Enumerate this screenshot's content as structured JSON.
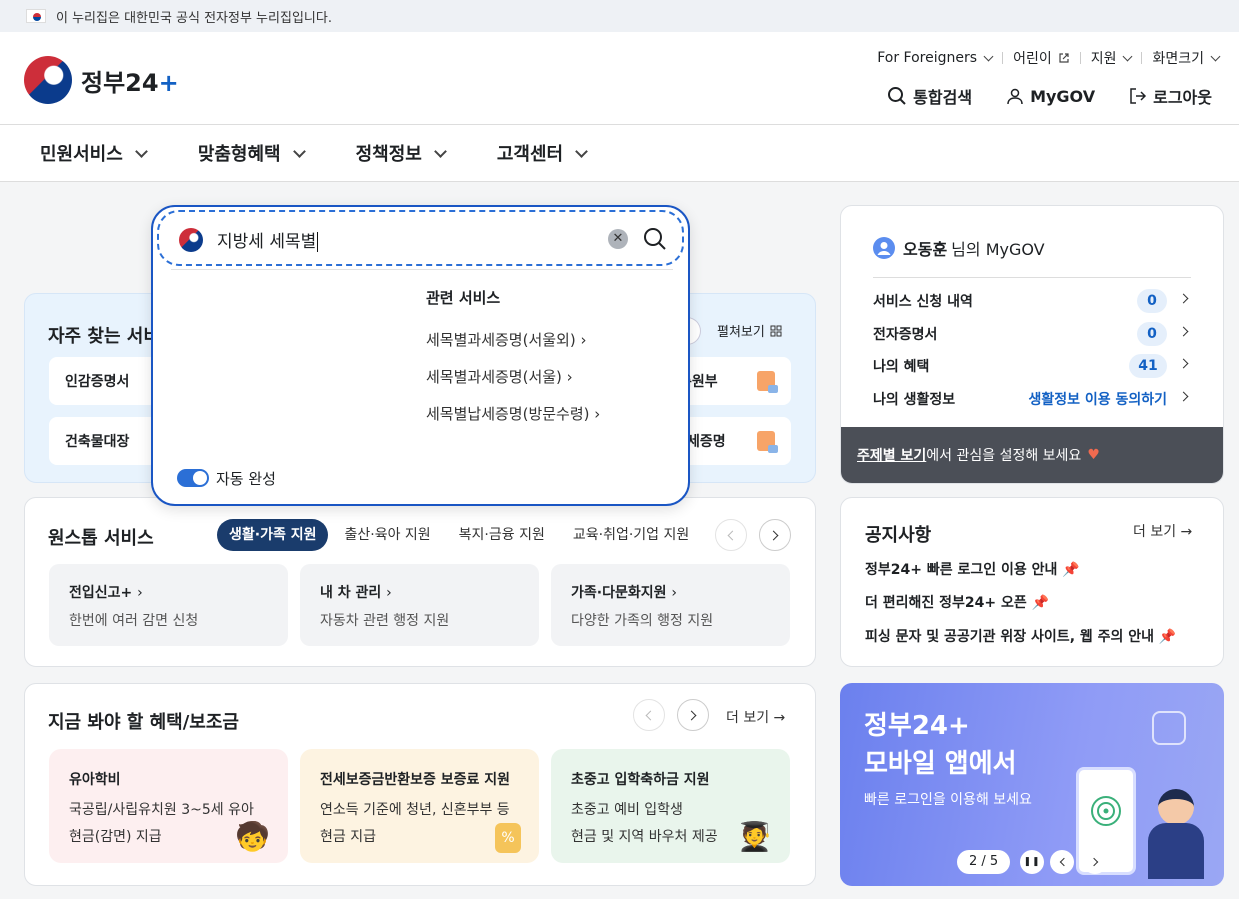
{
  "gov_banner": {
    "text": "이 누리집은 대한민국 공식 전자정부 누리집입니다."
  },
  "header": {
    "logo_text": "정부24",
    "logo_plus": "+",
    "util": [
      "For Foreigners",
      "어린이",
      "지원",
      "화면크기"
    ],
    "actions": {
      "search": "통합검색",
      "mygov": "MyGOV",
      "logout": "로그아웃"
    }
  },
  "gnb": [
    "민원서비스",
    "맞춤형혜택",
    "정책정보",
    "고객센터"
  ],
  "search": {
    "query": "지방세 세목별",
    "related_title": "관련 서비스",
    "related": [
      "세목별과세증명(서울외)",
      "세목별과세증명(서울)",
      "세목별납세증명(방문수령)"
    ],
    "autocomplete_label": "자동 완성"
  },
  "frequent": {
    "title": "자주 찾는 서비",
    "expand": "펼쳐보기",
    "items": [
      "인감증명서",
      "건축물대장",
      "록원부",
      "세증명"
    ]
  },
  "onestop": {
    "title": "원스톱 서비스",
    "chips": [
      "생활·가족 지원",
      "출산·육아 지원",
      "복지·금융 지원",
      "교육·취업·기업 지원"
    ],
    "boxes": [
      {
        "title": "전입신고+",
        "desc": "한번에 여러 감면 신청"
      },
      {
        "title": "내 차 관리",
        "desc": "자동차 관련 행정 지원"
      },
      {
        "title": "가족·다문화지원",
        "desc": "다양한 가족의 행정 지원"
      }
    ]
  },
  "benefits": {
    "title": "지금 봐야 할 혜택/보조금",
    "more": "더 보기",
    "items": [
      {
        "title": "유아학비",
        "line1": "국공립/사립유치원 3~5세 유아",
        "line2": "현금(감면) 지급",
        "color": "#fdeff0"
      },
      {
        "title": "전세보증금반환보증 보증료 지원",
        "line1": "연소득 기준에 청년, 신혼부부 등",
        "line2": "현금 지급",
        "color": "#fdf3e1"
      },
      {
        "title": "초중고 입학축하금 지원",
        "line1": "초중고 예비 입학생",
        "line2": "현금 및 지역 바우처 제공",
        "color": "#e9f5ec"
      }
    ]
  },
  "mygov": {
    "user": "오동훈",
    "suffix": "님의 MyGOV",
    "rows": [
      {
        "label": "서비스 신청 내역",
        "count": "0"
      },
      {
        "label": "전자증명서",
        "count": "0"
      },
      {
        "label": "나의 혜택",
        "count": "41"
      },
      {
        "label": "나의 생활정보",
        "link": "생활정보 이용 동의하기"
      }
    ],
    "footer_link": "주제별 보기",
    "footer_text": "에서 관심을 설정해 보세요"
  },
  "notice": {
    "title": "공지사항",
    "more": "더 보기",
    "items": [
      "정부24+ 빠른 로그인 이용 안내",
      "더 편리해진 정부24+ 오픈",
      "피싱 문자 및 공공기관 위장 사이트, 웹 주의 안내"
    ]
  },
  "banner": {
    "line1": "정부24+",
    "line2": "모바일 앱에서",
    "sub": "빠른 로그인을 이용해 보세요",
    "pager": "2 / 5"
  }
}
